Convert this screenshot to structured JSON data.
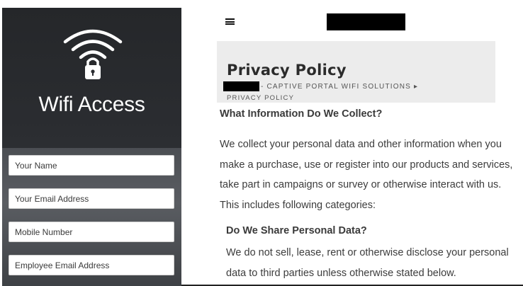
{
  "left_panel": {
    "title": "Wifi Access",
    "logo_icon": "wifi-lock-icon",
    "fields": [
      {
        "placeholder": "Your Name"
      },
      {
        "placeholder": "Your Email Address"
      },
      {
        "placeholder": "Mobile Number"
      },
      {
        "placeholder": "Employee Email Address"
      }
    ]
  },
  "header": {
    "menu_icon": "hamburger-menu-icon"
  },
  "page": {
    "title": "Privacy Policy",
    "breadcrumb_link": "- CAPTIVE PORTAL WIFI SOLUTIONS ▸",
    "breadcrumb_current": "PRIVACY POLICY"
  },
  "content": {
    "section1_heading": "What Information Do We Collect?",
    "section1_lines": [
      "We collect your personal data and other information when you",
      "make a purchase, use or register into our products and services,",
      "take part in campaigns or survey or otherwise interact with us.",
      "This includes following categories:"
    ],
    "section2_heading": "Do We Share Personal Data?",
    "section2_lines": [
      "We do not sell, lease, rent or otherwise disclose your personal",
      "data to third parties unless otherwise stated below."
    ]
  },
  "colors": {
    "panel_dark": "#25272a",
    "title_box": "#ececec",
    "text": "#333333"
  }
}
